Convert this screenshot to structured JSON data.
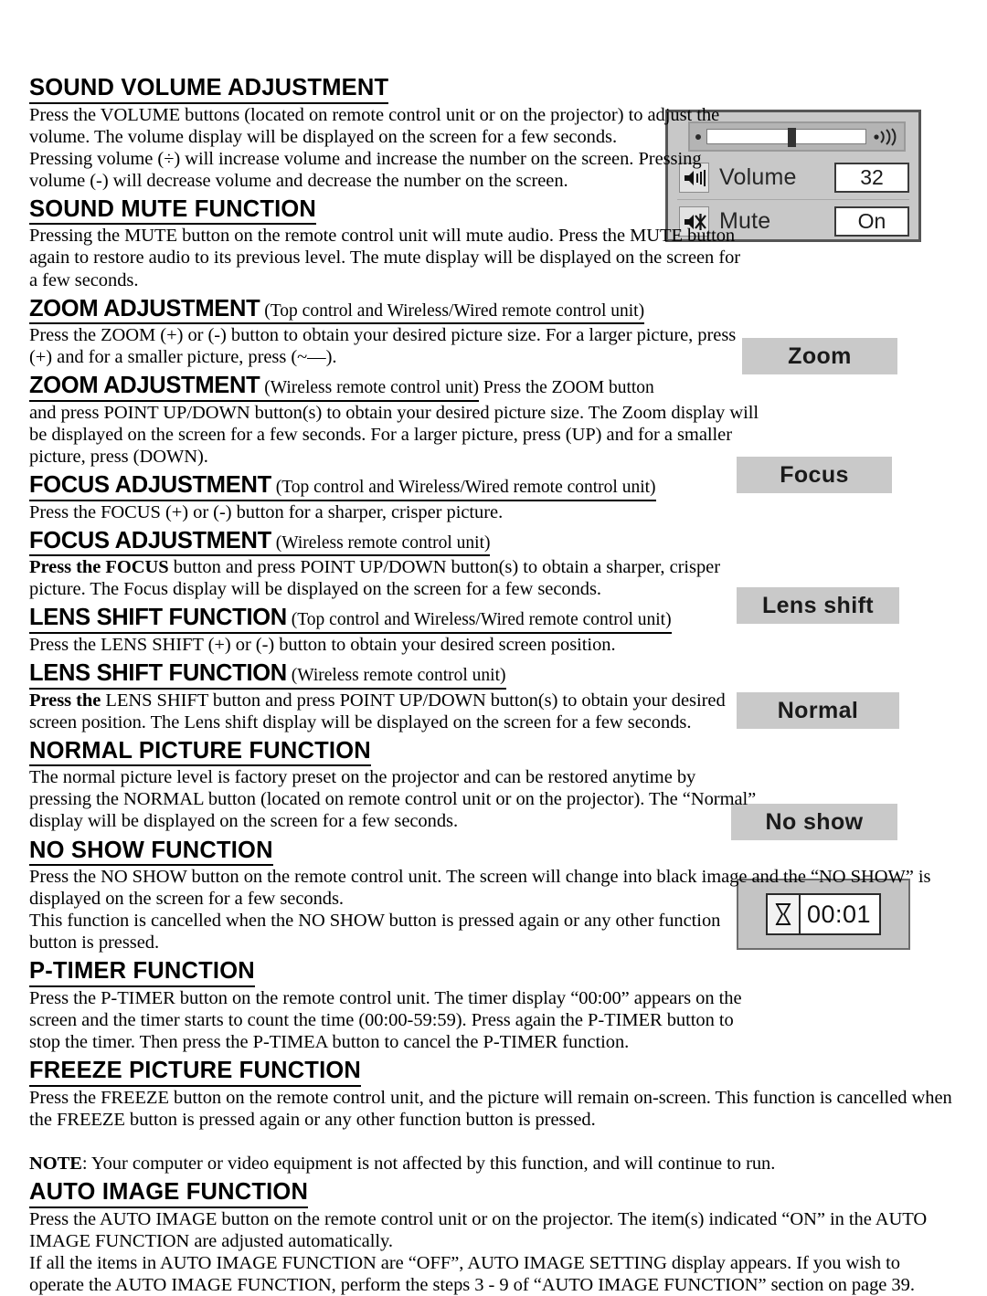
{
  "document": {
    "sections": [
      {
        "id": "sound-volume-adjustment",
        "heading": "SOUND VOLUME ADJUSTMENT",
        "paragraphs": [
          "Press the VOLUME buttons (located on remote control unit or on the projector) to adjust the volume. The volume display will be displayed on the screen for a few seconds.",
          "Pressing volume (÷) will increase volume and increase the number on the screen. Pressing volume (-) will decrease volume and decrease the number on the screen."
        ]
      },
      {
        "id": "sound-mute-function",
        "heading": "SOUND MUTE FUNCTION",
        "paragraphs": [
          "Pressing the MUTE button on the remote control unit will mute audio. Press the MUTE button again to restore audio to its previous level. The mute display will be displayed on the screen for a few seconds."
        ]
      },
      {
        "id": "zoom-adjustment-top",
        "heading": "ZOOM ADJUSTMENT",
        "heading_note": " (Top control and Wireless/Wired remote control unit)",
        "paragraphs": [
          "Press the ZOOM (+) or (-) button to obtain your desired picture size. For a larger picture, press (+) and for a smaller picture, press (~—)."
        ]
      },
      {
        "id": "zoom-adjustment-wireless",
        "heading": "ZOOM ADJUSTMENT",
        "heading_note": " (Wireless remote control unit)",
        "heading_tail": " Press the ZOOM button",
        "paragraphs": [
          "and press POINT UP/DOWN button(s) to obtain your desired picture size. The Zoom display will be displayed on the screen for a few seconds. For a larger picture, press (UP) and for a smaller picture, press (DOWN)."
        ]
      },
      {
        "id": "focus-adjustment-top",
        "heading": "FOCUS ADJUSTMENT",
        "heading_note": " (Top control and Wireless/Wired remote control unit)",
        "paragraphs": [
          "Press the FOCUS (+) or (-) button for a sharper, crisper picture."
        ]
      },
      {
        "id": "focus-adjustment-wireless",
        "heading": "FOCUS ADJUSTMENT",
        "heading_note": " (Wireless remote control unit)",
        "paragraphs": [
          "Press the FOCUS button and press POINT UP/DOWN button(s) to obtain a sharper, crisper picture. The Focus display will be displayed on the screen for a few seconds."
        ],
        "bold_lead": "Press the FOCUS"
      },
      {
        "id": "lens-shift-function-top",
        "heading": "LENS SHIFT FUNCTION",
        "heading_note": " (Top control and Wireless/Wired remote control unit)",
        "paragraphs": [
          "Press the LENS SHIFT (+) or (-) button to obtain your desired screen position."
        ]
      },
      {
        "id": "lens-shift-function-wireless",
        "heading": "LENS SHIFT FUNCTION",
        "heading_note": " (Wireless remote control unit)",
        "paragraphs": [
          "Press the LENS SHIFT button and press POINT UP/DOWN button(s) to obtain your desired screen position. The Lens shift display will be displayed on the screen for a few seconds."
        ],
        "bold_lead": "Press the"
      },
      {
        "id": "normal-picture-function",
        "heading": "NORMAL PICTURE FUNCTION",
        "paragraphs": [
          "The normal picture level is factory preset on the projector and can be restored anytime by pressing the NORMAL button (located on remote control unit or on the projector). The “Normal” display will be displayed on the screen for a few seconds."
        ]
      },
      {
        "id": "no-show-function",
        "heading": "NO SHOW FUNCTION",
        "paragraphs": [
          "Press the NO SHOW button on the remote control unit. The screen will change into black image and the “NO SHOW” is displayed on the screen for a few seconds.",
          "This function is cancelled when the NO SHOW button is pressed again or any other function button is pressed."
        ]
      },
      {
        "id": "p-timer-function",
        "heading": "P-TIMER FUNCTION",
        "paragraphs": [
          "Press the P-TIMER button on the remote control unit. The timer display “00:00” appears on the screen and the timer starts to count the time (00:00-59:59). Press again the P-TIMER button to stop the timer. Then press the P-TIMEA button to cancel the P-TIMER function."
        ]
      },
      {
        "id": "freeze-picture-function",
        "heading": "FREEZE PICTURE FUNCTION",
        "paragraphs": [
          "Press the FREEZE button on the remote control unit, and the picture will remain on-screen. This function is cancelled when the FREEZE button is pressed again or any other function button is pressed."
        ],
        "note_label": "NOTE",
        "note_text": ": Your computer or video equipment is not affected by this function, and will continue to run."
      },
      {
        "id": "auto-image-function",
        "heading": "AUTO IMAGE FUNCTION",
        "paragraphs": [
          "Press the AUTO IMAGE button on the remote control unit or on the projector. The item(s) indicated “ON” in the AUTO IMAGE FUNCTION are adjusted automatically.",
          "If all the items in AUTO IMAGE FUNCTION are “OFF”, AUTO IMAGE SETTING display appears. If you wish to operate the AUTO IMAGE FUNCTION, perform the steps 3 - 9 of “AUTO IMAGE FUNCTION” section on page 39."
        ]
      }
    ]
  },
  "osd_graphics": {
    "volume_panel": {
      "rows": [
        {
          "icon": "speaker-on-icon",
          "label": "Volume",
          "value": "32"
        },
        {
          "icon": "speaker-mute-icon",
          "label": "Mute",
          "value": "On"
        }
      ]
    },
    "zoom_display": "Zoom",
    "focus_display": "Focus",
    "lens_shift_display": "Lens shift",
    "normal_display": "Normal",
    "no_show_display": "No show",
    "p_timer_display": "00:01"
  },
  "colors": {
    "osd_background": "#c9c9c9",
    "osd_text": "#1a1a1a",
    "page_background": "#ffffff",
    "body_text": "#000000"
  }
}
